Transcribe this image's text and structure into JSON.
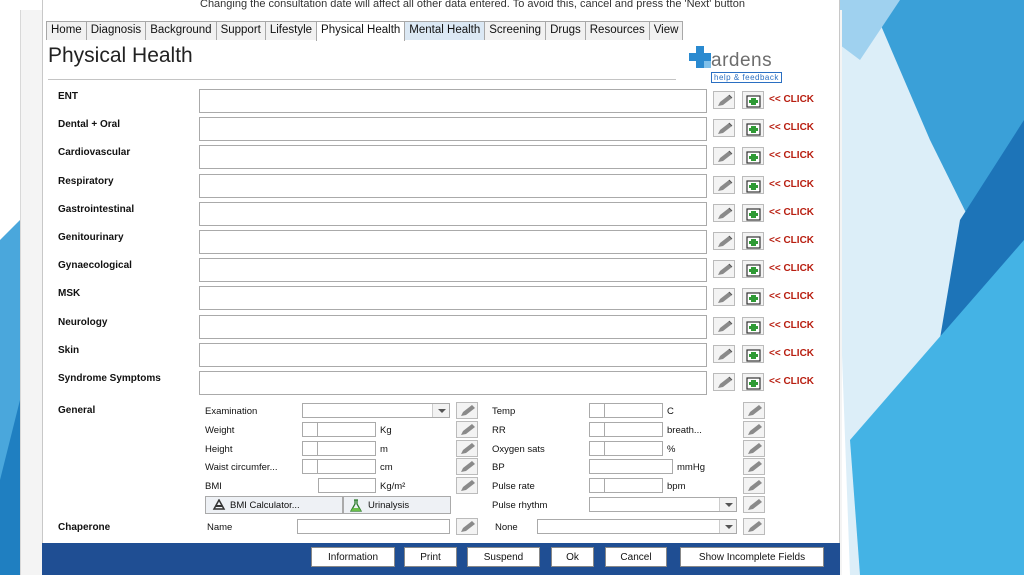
{
  "warning_text": "Changing the consultation date will affect all other data entered. To avoid this, cancel and press the 'Next' button",
  "tabs": [
    {
      "label": "Home"
    },
    {
      "label": "Diagnosis"
    },
    {
      "label": "Background"
    },
    {
      "label": "Support"
    },
    {
      "label": "Lifestyle"
    },
    {
      "label": "Physical Health"
    },
    {
      "label": "Mental Health"
    },
    {
      "label": "Screening"
    },
    {
      "label": "Drugs"
    },
    {
      "label": "Resources"
    },
    {
      "label": "View"
    }
  ],
  "active_tab": "Physical Health",
  "page_title": "Physical Health",
  "logo": {
    "name": "ardens",
    "help": "help & feedback"
  },
  "click_label": "<< CLICK",
  "systems": [
    {
      "label": "ENT",
      "value": ""
    },
    {
      "label": "Dental + Oral",
      "value": ""
    },
    {
      "label": "Cardiovascular",
      "value": ""
    },
    {
      "label": "Respiratory",
      "value": ""
    },
    {
      "label": "Gastrointestinal",
      "value": ""
    },
    {
      "label": "Genitourinary",
      "value": ""
    },
    {
      "label": "Gynaecological",
      "value": ""
    },
    {
      "label": "MSK",
      "value": ""
    },
    {
      "label": "Neurology",
      "value": ""
    },
    {
      "label": "Skin",
      "value": ""
    },
    {
      "label": "Syndrome Symptoms",
      "value": ""
    }
  ],
  "general": {
    "label": "General",
    "left": [
      {
        "label": "Examination",
        "unit": "",
        "type": "select",
        "value": ""
      },
      {
        "label": "Weight",
        "unit": "Kg",
        "type": "number",
        "value": ""
      },
      {
        "label": "Height",
        "unit": "m",
        "type": "number",
        "value": ""
      },
      {
        "label": "Waist circumfer...",
        "unit": "cm",
        "type": "number",
        "value": ""
      },
      {
        "label": "BMI",
        "unit": "Kg/m²",
        "type": "number",
        "value": ""
      }
    ],
    "right": [
      {
        "label": "Temp",
        "unit": "C",
        "type": "number",
        "value": ""
      },
      {
        "label": "RR",
        "unit": "breath...",
        "type": "number",
        "value": ""
      },
      {
        "label": "Oxygen sats",
        "unit": "%",
        "type": "number",
        "value": ""
      },
      {
        "label": "BP",
        "unit": "mmHg",
        "type": "text",
        "value": ""
      },
      {
        "label": "Pulse rate",
        "unit": "bpm",
        "type": "number",
        "value": ""
      },
      {
        "label": "Pulse rhythm",
        "unit": "",
        "type": "select",
        "value": ""
      }
    ],
    "bmi_calculator": "BMI Calculator...",
    "urinalysis": "Urinalysis"
  },
  "chaperone": {
    "label": "Chaperone",
    "name_label": "Name",
    "name_value": "",
    "none_label": "None",
    "none_value": ""
  },
  "footer_buttons": [
    "Information",
    "Print",
    "Suspend",
    "Ok",
    "Cancel",
    "Show Incomplete Fields"
  ],
  "colors": {
    "footer": "#1f4e93",
    "click": "#b81e10",
    "slide_accent": "#2f8fc8"
  }
}
